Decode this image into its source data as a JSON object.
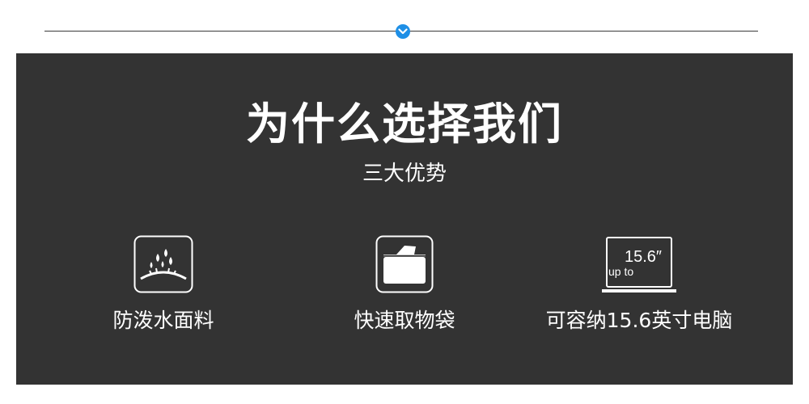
{
  "divider": {
    "badge_icon": "chevron-down-icon",
    "badge_color": "#1e8fe6",
    "line_color": "#3a3a3a"
  },
  "panel": {
    "background": "#333333",
    "title": "为什么选择我们",
    "subtitle": "三大优势",
    "features": [
      {
        "icon": "water-drops-icon",
        "label": "防泼水面料"
      },
      {
        "icon": "pocket-bag-icon",
        "label": "快速取物袋"
      },
      {
        "icon": "laptop-icon",
        "label": "可容纳15.6英寸电脑",
        "icon_text_size": "15.6″",
        "icon_text_upto": "up to"
      }
    ]
  }
}
